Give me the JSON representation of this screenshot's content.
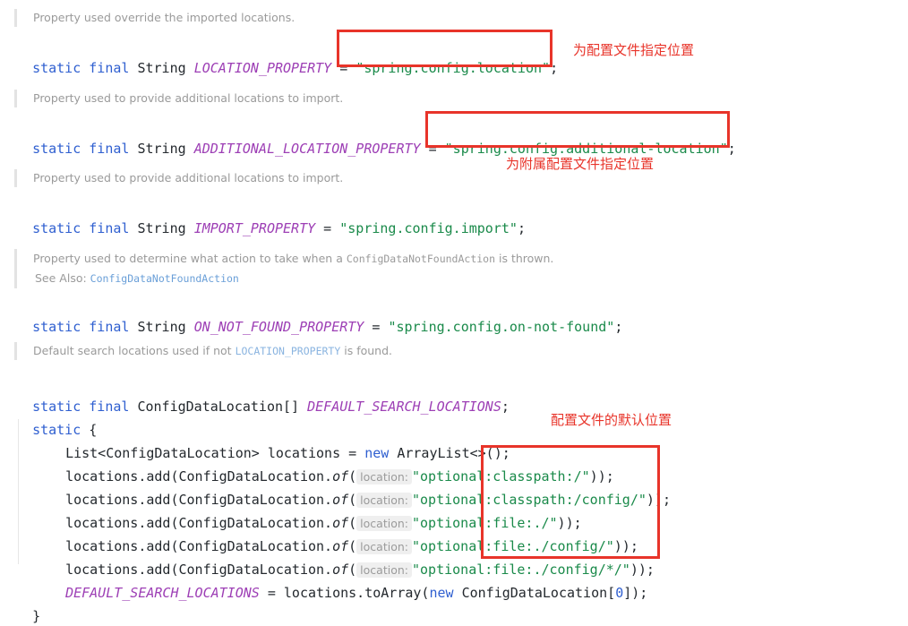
{
  "doc_blocks": [
    {
      "id": "doc-location-property",
      "lines": [
        {
          "segments": [
            {
              "type": "text",
              "value": "Property used override the imported locations."
            }
          ]
        }
      ]
    },
    {
      "id": "doc-additional-location-property",
      "lines": [
        {
          "segments": [
            {
              "type": "text",
              "value": "Property used to provide additional locations to import."
            }
          ]
        }
      ]
    },
    {
      "id": "doc-import-property",
      "lines": [
        {
          "segments": [
            {
              "type": "text",
              "value": "Property used to provide additional locations to import."
            }
          ]
        }
      ]
    },
    {
      "id": "doc-on-not-found-property",
      "lines": [
        {
          "segments": [
            {
              "type": "text",
              "value": "Property used to determine what action to take when a "
            },
            {
              "type": "code",
              "value": "ConfigDataNotFoundAction"
            },
            {
              "type": "text",
              "value": " is thrown."
            }
          ]
        },
        {
          "segments": [
            {
              "type": "text",
              "value": "See Also: "
            },
            {
              "type": "link",
              "value": "ConfigDataNotFoundAction"
            }
          ]
        }
      ]
    },
    {
      "id": "doc-default-search-locations",
      "lines": [
        {
          "segments": [
            {
              "type": "text",
              "value": "Default search locations used if not "
            },
            {
              "type": "bluecode",
              "value": "LOCATION_PROPERTY"
            },
            {
              "type": "text",
              "value": " is found."
            }
          ]
        }
      ]
    }
  ],
  "code": {
    "location_property": {
      "modifiers": "static final",
      "type": "String",
      "name": "LOCATION_PROPERTY",
      "equals": " = ",
      "value": "\"spring.config.location\"",
      "semicolon": ";"
    },
    "additional_location_property": {
      "modifiers": "static final",
      "type": "String",
      "name": "ADDITIONAL_LOCATION_PROPERTY",
      "equals": " = ",
      "value": "\"spring.config.additional-location\"",
      "semicolon": ";"
    },
    "import_property": {
      "modifiers": "static final",
      "type": "String",
      "name": "IMPORT_PROPERTY",
      "equals": " = ",
      "value": "\"spring.config.import\"",
      "semicolon": ";"
    },
    "on_not_found_property": {
      "modifiers": "static final",
      "type": "String",
      "name": "ON_NOT_FOUND_PROPERTY",
      "equals": " = ",
      "value": "\"spring.config.on-not-found\"",
      "semicolon": ";"
    },
    "default_search_locations_decl": {
      "modifiers": "static final",
      "type": "ConfigDataLocation[]",
      "name": "DEFAULT_SEARCH_LOCATIONS",
      "semicolon": ";"
    },
    "static_block_open": {
      "keyword": "static",
      "brace": " {"
    },
    "list_decl": {
      "type": "List<ConfigDataLocation>",
      "name": " locations = ",
      "new_keyword": "new",
      "ctor": " ArrayList<>();"
    },
    "locations_add": [
      {
        "prefix": "locations.add(ConfigDataLocation.",
        "method": "of",
        "open_paren": "(",
        "hint": "location:",
        "string_prefix": "\"optional:",
        "string_path": "classpath:/\"",
        "suffix": "));"
      },
      {
        "prefix": "locations.add(ConfigDataLocation.",
        "method": "of",
        "open_paren": "(",
        "hint": "location:",
        "string_prefix": "\"optional:",
        "string_path": "classpath:/config/\"",
        "suffix": "));"
      },
      {
        "prefix": "locations.add(ConfigDataLocation.",
        "method": "of",
        "open_paren": "(",
        "hint": "location:",
        "string_prefix": "\"optional:",
        "string_path": "file:./\"",
        "suffix": "));"
      },
      {
        "prefix": "locations.add(ConfigDataLocation.",
        "method": "of",
        "open_paren": "(",
        "hint": "location:",
        "string_prefix": "\"optional:",
        "string_path": "file:./config/\"",
        "suffix": "));"
      },
      {
        "prefix": "locations.add(ConfigDataLocation.",
        "method": "of",
        "open_paren": "(",
        "hint": "location:",
        "string_prefix": "\"optional:",
        "string_path": "file:./config/*/\"",
        "suffix": "));"
      }
    ],
    "to_array_line": {
      "name": "DEFAULT_SEARCH_LOCATIONS",
      "equals": " = locations.toArray(",
      "new_keyword": "new",
      "ctor": " ConfigDataLocation[",
      "number": "0",
      "tail": "]);"
    },
    "static_block_close": {
      "brace": "}"
    }
  },
  "annotations": {
    "note_location": "为配置文件指定位置",
    "note_additional_location": "为附属配置文件指定位置",
    "note_default_locations": "配置文件的默认位置"
  },
  "colors": {
    "highlight_box": "#e8342a",
    "annotation_text": "#e8342a",
    "keyword": "#2f5fd0",
    "field_name": "#9d3fb5",
    "string": "#1a8a4a",
    "number": "#2f5fd0",
    "doc_text": "#9a9a9a",
    "doc_link": "#6a9fd8",
    "code_text": "#24292e",
    "hint_bg": "#efefef",
    "background": "#ffffff"
  }
}
